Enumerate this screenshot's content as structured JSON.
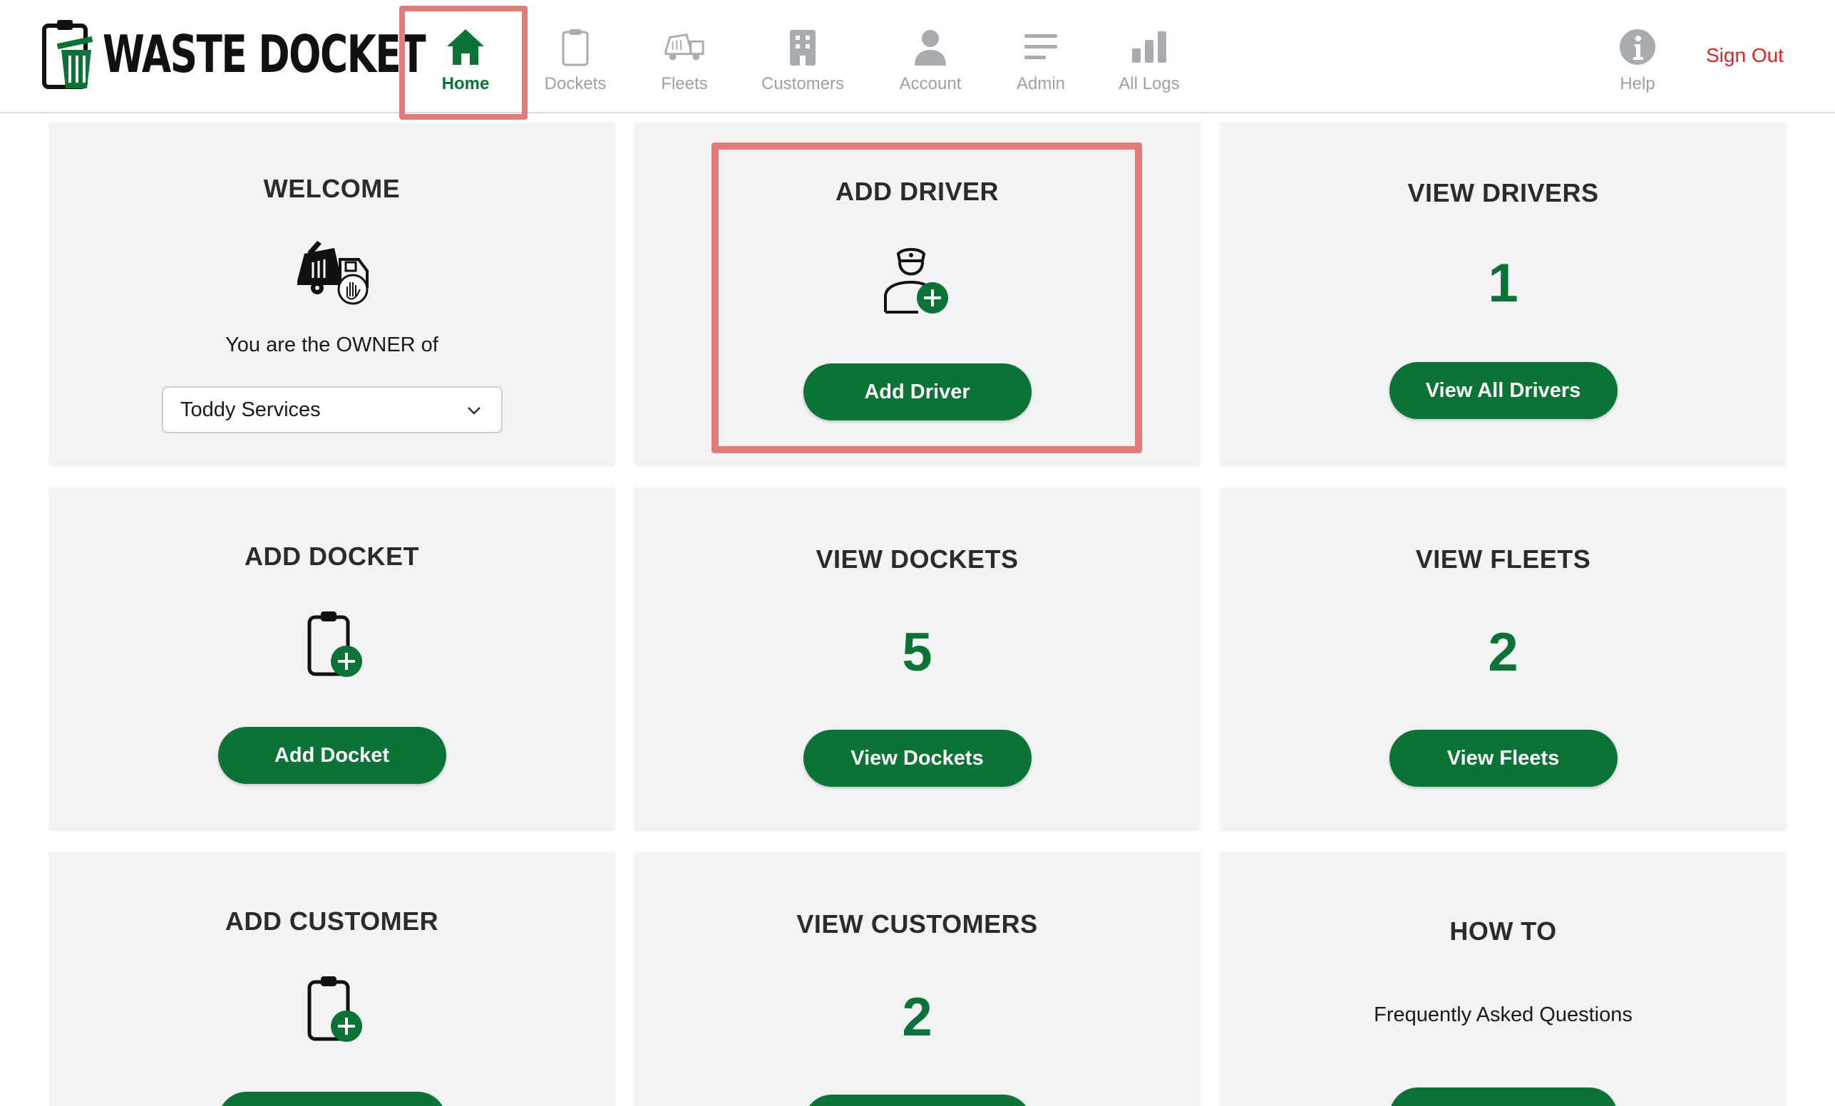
{
  "brand": {
    "name": "WASTE DOCKET"
  },
  "nav": {
    "items": [
      {
        "label": "Home",
        "icon": "home-icon",
        "active": true
      },
      {
        "label": "Dockets",
        "icon": "clipboard-icon"
      },
      {
        "label": "Fleets",
        "icon": "truck-icon"
      },
      {
        "label": "Customers",
        "icon": "building-icon"
      },
      {
        "label": "Account",
        "icon": "user-icon"
      },
      {
        "label": "Admin",
        "icon": "menu-lines-icon"
      },
      {
        "label": "All Logs",
        "icon": "bar-chart-icon"
      }
    ],
    "help": {
      "label": "Help",
      "icon": "info-icon"
    },
    "signout": "Sign Out"
  },
  "colors": {
    "accent": "#0b7335",
    "highlight": "#e27c7a",
    "signout": "#df2320",
    "card_bg": "#f2f3f5"
  },
  "cards": {
    "welcome": {
      "title": "WELCOME",
      "icon": "skip-truck-icon",
      "text": "You are the OWNER of",
      "select_value": "Toddy Services"
    },
    "add_driver": {
      "title": "ADD DRIVER",
      "icon": "add-driver-icon",
      "button": "Add Driver"
    },
    "view_drivers": {
      "title": "VIEW DRIVERS",
      "count": "1",
      "button": "View All Drivers"
    },
    "add_docket": {
      "title": "ADD DOCKET",
      "icon": "add-clipboard-icon",
      "button": "Add Docket"
    },
    "view_dockets": {
      "title": "VIEW DOCKETS",
      "count": "5",
      "button": "View Dockets"
    },
    "view_fleets": {
      "title": "VIEW FLEETS",
      "count": "2",
      "button": "View Fleets"
    },
    "add_customer": {
      "title": "ADD CUSTOMER",
      "icon": "add-clipboard-icon"
    },
    "view_customers": {
      "title": "VIEW CUSTOMERS",
      "count": "2"
    },
    "how_to": {
      "title": "HOW TO",
      "text": "Frequently Asked Questions"
    }
  }
}
